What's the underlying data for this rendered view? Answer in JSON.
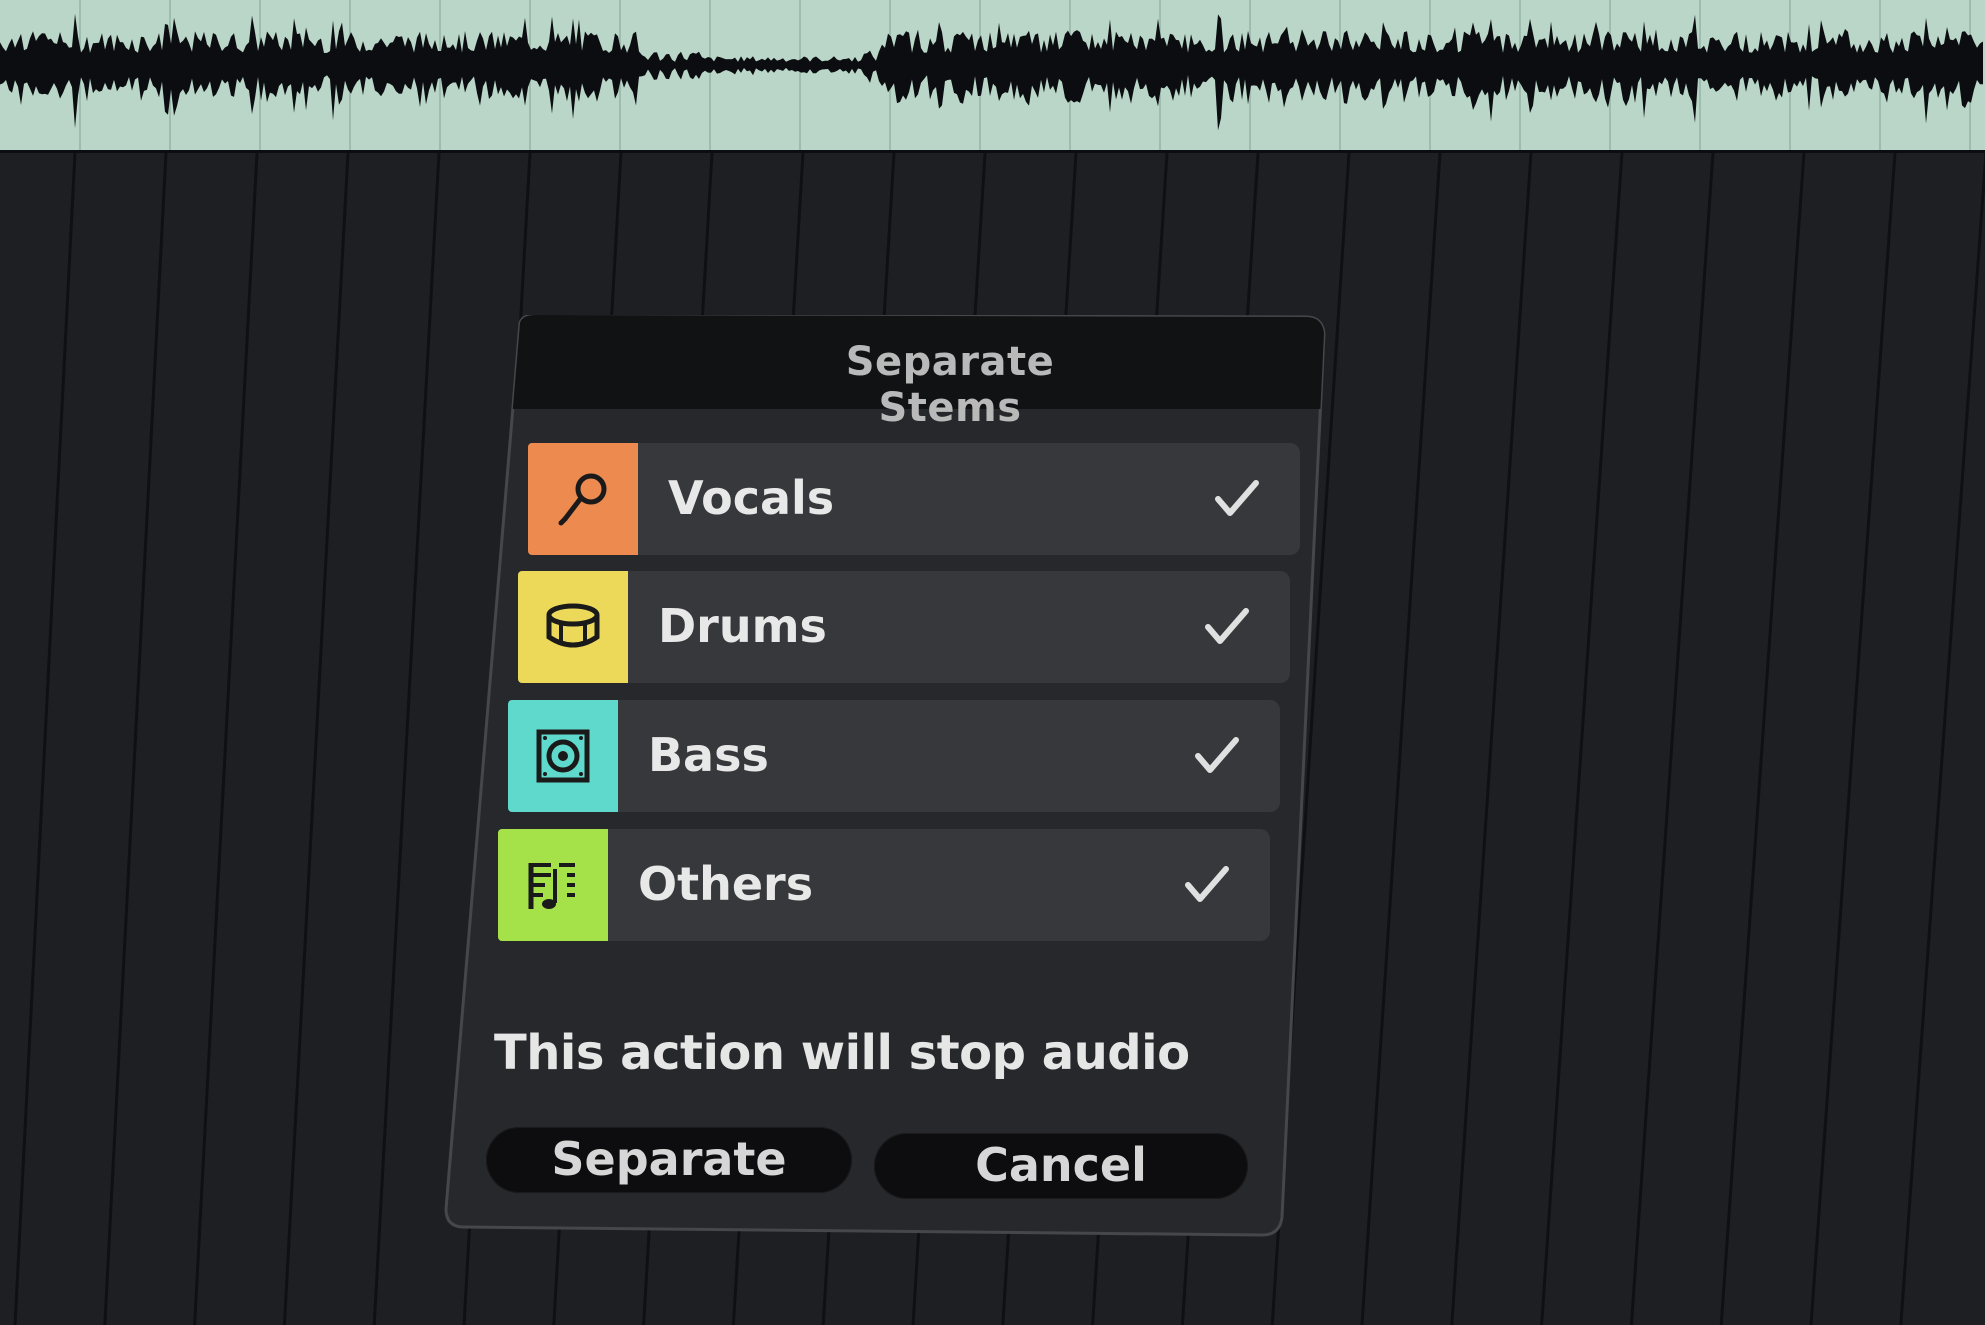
{
  "dialog": {
    "title": "Separate Stems",
    "stems": [
      {
        "label": "Vocals",
        "icon": "microphone-icon",
        "color": "#ed8a4f",
        "checked": true
      },
      {
        "label": "Drums",
        "icon": "drum-icon",
        "color": "#ecd95a",
        "checked": true
      },
      {
        "label": "Bass",
        "icon": "speaker-icon",
        "color": "#5fd9cc",
        "checked": true
      },
      {
        "label": "Others",
        "icon": "sheet-music-icon",
        "color": "#a5e24a",
        "checked": true
      }
    ],
    "warning": "This action will stop audio",
    "separate_label": "Separate",
    "cancel_label": "Cancel"
  },
  "colors": {
    "waveform_bg": "#b9d6c8",
    "waveform": "#0c0d10",
    "arrangement_bg": "#1e1f23",
    "dialog_bg": "#26272b",
    "row_bg": "#37383c"
  }
}
